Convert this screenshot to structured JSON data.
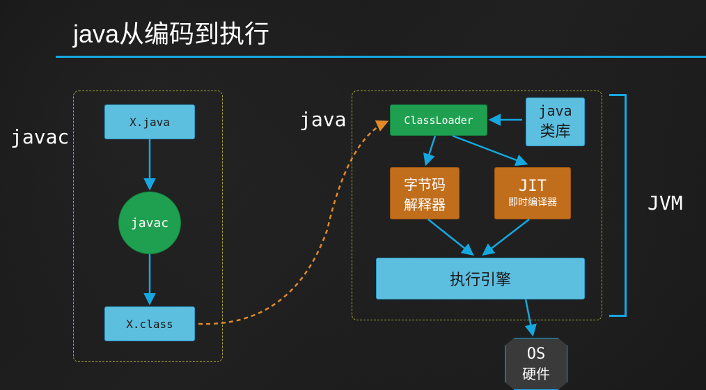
{
  "title": "java从编码到执行",
  "left_group": {
    "label": "javac",
    "source_file": "X.java",
    "compiler": "javac",
    "output_file": "X.class"
  },
  "right_group": {
    "label": "java",
    "classloader": "ClassLoader",
    "library_line1": "java",
    "library_line2": "类库",
    "interpreter_line1": "字节码",
    "interpreter_line2": "解释器",
    "jit_line1": "JIT",
    "jit_line2": "即时编译器",
    "engine": "执行引擎",
    "os_line1": "OS",
    "os_line2": "硬件"
  },
  "jvm_label": "JVM",
  "colors": {
    "blue": "#5dbfe0",
    "green": "#1fa050",
    "orange": "#c16e1c",
    "accent": "#15a8e0"
  }
}
